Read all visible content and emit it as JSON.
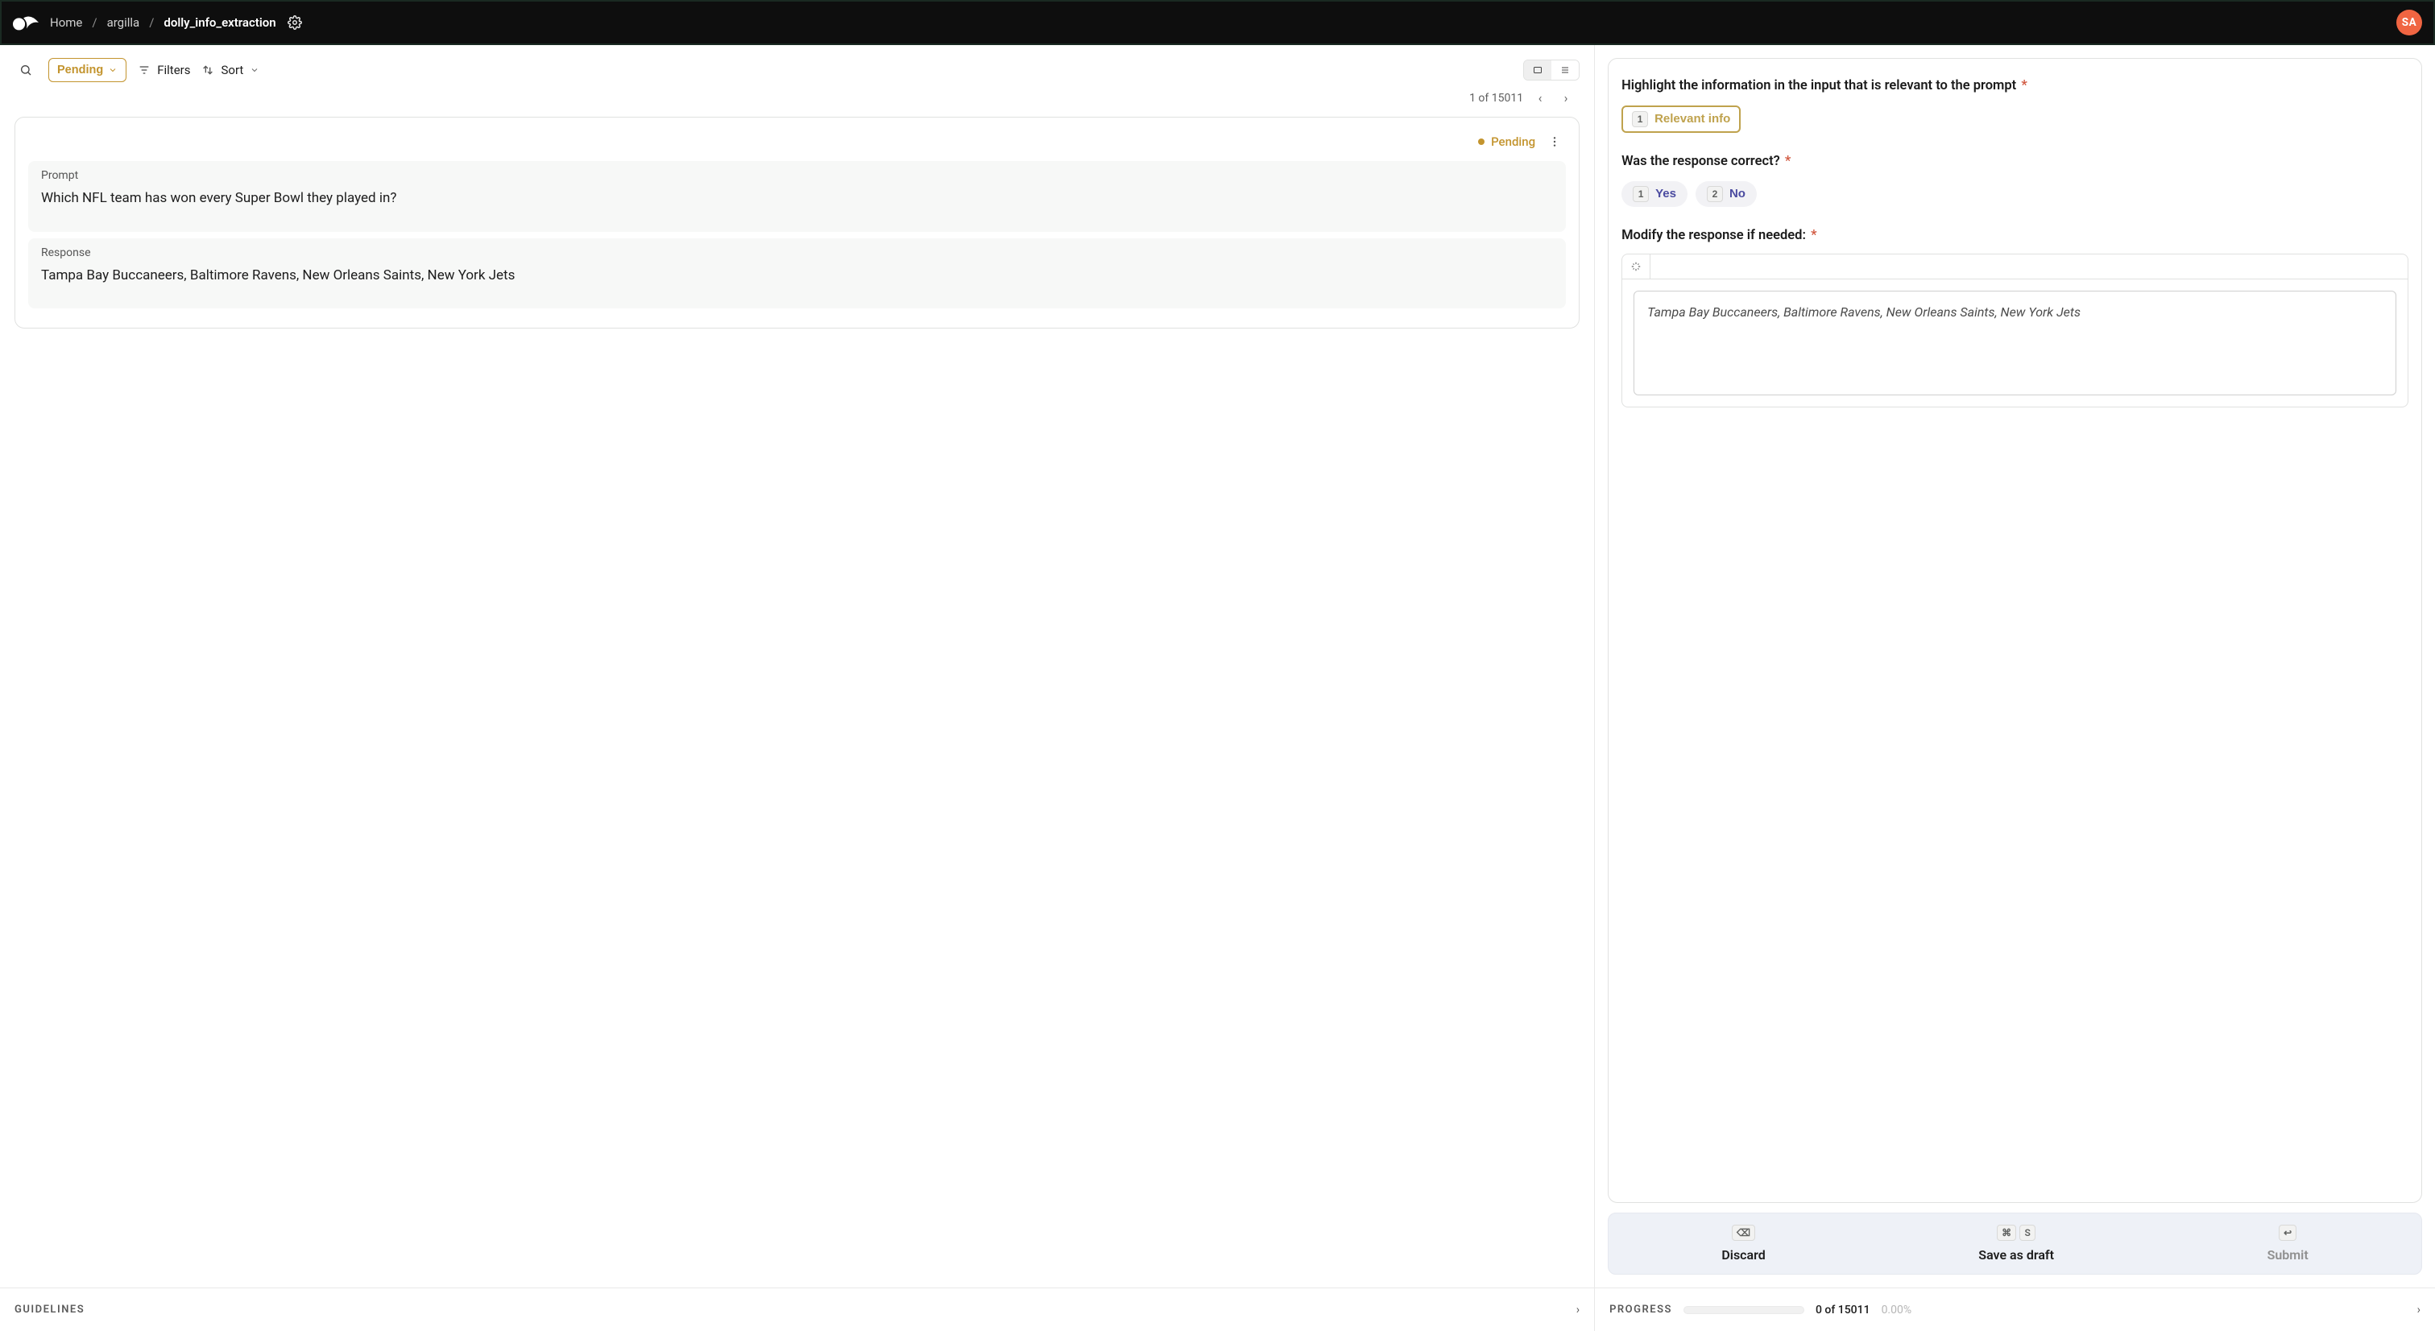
{
  "header": {
    "breadcrumbs": [
      "Home",
      "argilla",
      "dolly_info_extraction"
    ],
    "avatar_initials": "SA"
  },
  "toolbar": {
    "status_filter": "Pending",
    "filters_label": "Filters",
    "sort_label": "Sort"
  },
  "pagination": {
    "text": "1 of 15011"
  },
  "record": {
    "status": "Pending",
    "fields": [
      {
        "label": "Prompt",
        "value": "Which NFL team has won every Super Bowl they played in?"
      },
      {
        "label": "Response",
        "value": "Tampa Bay Buccaneers, Baltimore Ravens, New Orleans Saints, New York Jets"
      }
    ]
  },
  "questions": {
    "span": {
      "title": "Highlight the information in the input that is relevant to the prompt",
      "label_key": "1",
      "label_text": "Relevant info"
    },
    "label": {
      "title": "Was the response correct?",
      "options": [
        {
          "key": "1",
          "text": "Yes"
        },
        {
          "key": "2",
          "text": "No"
        }
      ]
    },
    "text": {
      "title": "Modify the response if needed:",
      "value": "Tampa Bay Buccaneers, Baltimore Ravens, New Orleans Saints, New York Jets"
    }
  },
  "actions": {
    "discard": {
      "label": "Discard",
      "keys": [
        "⌫"
      ]
    },
    "draft": {
      "label": "Save as draft",
      "keys": [
        "⌘",
        "S"
      ]
    },
    "submit": {
      "label": "Submit",
      "keys": [
        "↩"
      ]
    }
  },
  "footer": {
    "guidelines_label": "GUIDELINES",
    "progress_label": "PROGRESS",
    "progress_text": "0 of 15011",
    "progress_percent": "0.00%"
  }
}
